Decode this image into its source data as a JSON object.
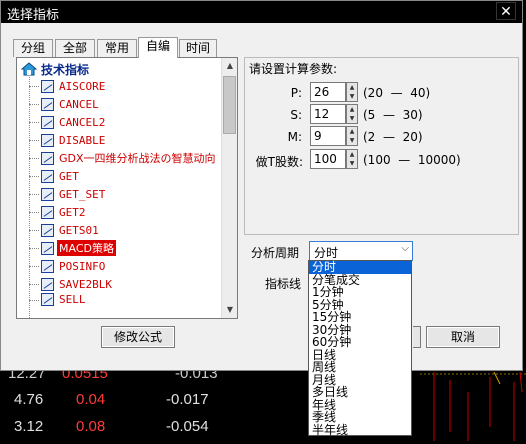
{
  "dialog": {
    "title": "选择指标",
    "close_glyph": "✕"
  },
  "tabs": [
    {
      "label": "分组"
    },
    {
      "label": "全部"
    },
    {
      "label": "常用"
    },
    {
      "label": "自编"
    },
    {
      "label": "时间"
    }
  ],
  "active_tab": "自编",
  "tree": {
    "root_label": "技术指标",
    "items": [
      {
        "label": "AISCORE"
      },
      {
        "label": "CANCEL"
      },
      {
        "label": "CANCEL2"
      },
      {
        "label": "DISABLE"
      },
      {
        "label": "GDX一四维分析战法の智慧动向"
      },
      {
        "label": "GET"
      },
      {
        "label": "GET_SET"
      },
      {
        "label": "GET2"
      },
      {
        "label": "GETS01"
      },
      {
        "label": "MACD策略"
      },
      {
        "label": "POSINFO"
      },
      {
        "label": "SAVE2BLK"
      },
      {
        "label": "SELL"
      }
    ],
    "selected": "MACD策略"
  },
  "buttons": {
    "modify_formula": "修改公式",
    "cancel": "取消"
  },
  "params": {
    "title": "请设置计算参数:",
    "rows": [
      {
        "label": "P:",
        "value": "26",
        "range": "(20  —  40)"
      },
      {
        "label": "S:",
        "value": "12",
        "range": "(5  —  30)"
      },
      {
        "label": "M:",
        "value": "9",
        "range": "(2  —  20)"
      },
      {
        "label": "做T股数:",
        "value": "100",
        "range": "(100  —  10000)"
      }
    ]
  },
  "period": {
    "label": "分析周期",
    "selected": "分时",
    "options": [
      "分时",
      "分笔成交",
      "1分钟",
      "5分钟",
      "15分钟",
      "30分钟",
      "60分钟",
      "日线",
      "周线",
      "月线",
      "多日线",
      "年线",
      "季线",
      "半年线"
    ]
  },
  "indicator_line_label": "指标线",
  "background_table": {
    "rows": [
      {
        "c1": "4.76",
        "c2": "0.04",
        "c3": "-0.017"
      },
      {
        "c1": "3.12",
        "c2": "0.08",
        "c3": "-0.054"
      }
    ]
  },
  "colors": {
    "selection_red": "#dd0000",
    "highlight_blue": "#0a64d8",
    "tree_text": "#cc0000"
  }
}
